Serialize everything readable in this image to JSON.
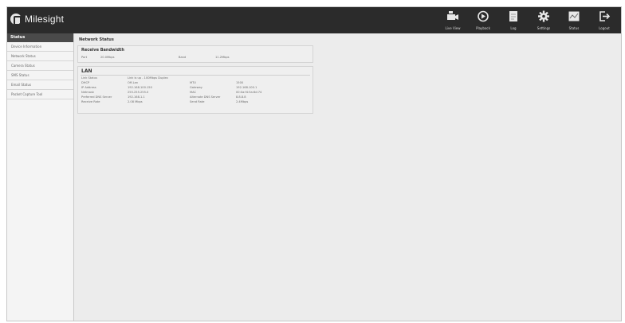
{
  "brand": {
    "logo_text": "Milesight"
  },
  "nav": [
    {
      "label": "Live View",
      "icon": "camera-icon"
    },
    {
      "label": "Playback",
      "icon": "playback-icon"
    },
    {
      "label": "Log",
      "icon": "log-icon"
    },
    {
      "label": "Settings",
      "icon": "gear-icon"
    },
    {
      "label": "Status",
      "icon": "status-icon"
    },
    {
      "label": "Logout",
      "icon": "logout-icon"
    }
  ],
  "sidebar": {
    "header": "Status",
    "items": [
      "Device Information",
      "Network Status",
      "Camera Status",
      "SMS Status",
      "Email Status",
      "Packet Capture Tool"
    ]
  },
  "page": {
    "title": "Network Status",
    "bandwidth": {
      "title": "Receive Bandwidth",
      "k1": "Port",
      "v1": "20.0Mbps",
      "k2": "Band",
      "v2": "11.2Mbps"
    },
    "lan": {
      "title": "LAN",
      "rows": [
        {
          "k1": "Link Status",
          "v1": "Link is up - 100Mbps Duplex",
          "k2": "",
          "v2": ""
        },
        {
          "k1": "DHCP",
          "v1": "Off-Lan",
          "k2": "MTU",
          "v2": "1500"
        },
        {
          "k1": "IP Address",
          "v1": "192.168.100.150",
          "k2": "Gateway",
          "v2": "192.168.100.1"
        },
        {
          "k1": "Netmask",
          "v1": "255.255.255.0",
          "k2": "MAC",
          "v2": "00:0a:f4:5a:6d:74"
        },
        {
          "k1": "Preferred DNS Server",
          "v1": "192.168.1.1",
          "k2": "Alternate DNS Server",
          "v2": "8.8.8.8"
        },
        {
          "k1": "Receive Rate",
          "v1": "2.08 Mbps",
          "k2": "Send Rate",
          "v2": "2.4Mbps"
        }
      ]
    }
  }
}
